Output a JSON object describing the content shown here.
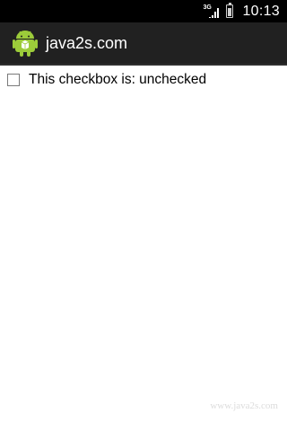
{
  "status_bar": {
    "network_label": "3G",
    "time": "10:13"
  },
  "action_bar": {
    "title": "java2s.com",
    "icon": "android-icon"
  },
  "content": {
    "checkbox": {
      "checked": false,
      "label": "This checkbox is: unchecked"
    }
  },
  "watermark": "www.java2s.com"
}
